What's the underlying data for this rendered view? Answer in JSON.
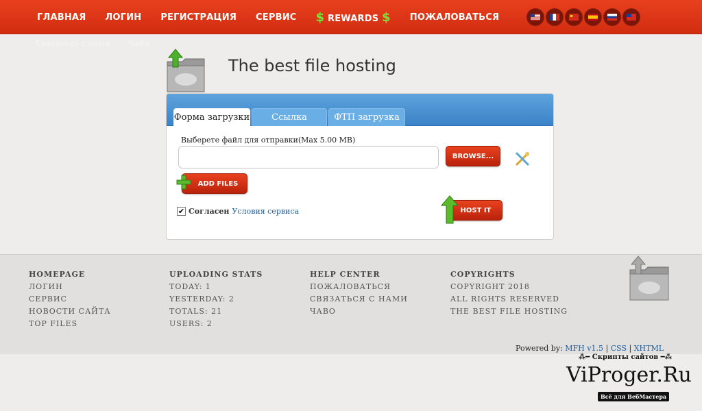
{
  "nav": {
    "items": [
      "Главная",
      "Логин",
      "Регистрация",
      "Сервис"
    ],
    "rewards": {
      "symbol": "$",
      "label": "Rewards"
    },
    "complain": "Пожаловаться",
    "flags": [
      "us-flag-icon",
      "fr-flag-icon",
      "cn-flag-icon",
      "es-flag-icon",
      "ru-flag-icon",
      "tw-flag-icon"
    ],
    "faint_links": [
      "Связаться с нами",
      "ЧаВо"
    ]
  },
  "header": {
    "title": "The best file hosting"
  },
  "upload": {
    "tabs": [
      "Форма загрузки",
      "Ссылка",
      "ФТП загрузка"
    ],
    "choose_label": "Выберете файл для отправки(Max 5.00 MB)",
    "file_value": "",
    "browse_label": "BROWSE...",
    "add_files_label": "ADD FILES",
    "agree_checked": true,
    "agree_text": "Согласен",
    "terms_link": "Условия сервиса",
    "host_label": "HOST IT"
  },
  "footer": {
    "columns": [
      {
        "heading": "HOMEPAGE",
        "items": [
          "ЛОГИН",
          "СЕРВИС",
          "НОВОСТИ САЙТА",
          "TOP FILES"
        ]
      },
      {
        "heading": "UPLOADING STATS",
        "items": [
          "TODAY: 1",
          "YESTERDAY: 2",
          "TOTALS: 21",
          "USERS: 2"
        ]
      },
      {
        "heading": "HELP CENTER",
        "items": [
          "ПОЖАЛОВАТЬСЯ",
          "СВЯЗАТЬСЯ С НАМИ",
          "ЧАВО"
        ]
      },
      {
        "heading": "COPYRIGHTS",
        "items": [
          "COPYRIGHT 2018",
          "ALL RIGHTS RESERVED",
          "THE BEST FILE HOSTING"
        ]
      }
    ],
    "powered": {
      "prefix": "Powered by:",
      "product": "MFH v1.5",
      "sep": "|",
      "css": "CSS",
      "xhtml": "XHTML"
    }
  },
  "watermark": {
    "tagline": "Скрипты сайтов",
    "site": "ViProger.Ru",
    "slogan": "Всё для ВебМастера"
  },
  "colors": {
    "brand_red": "#d12d10",
    "tab_blue": "#3b83c8",
    "link_blue": "#1f5c99",
    "rewards_green": "#7be03a"
  }
}
